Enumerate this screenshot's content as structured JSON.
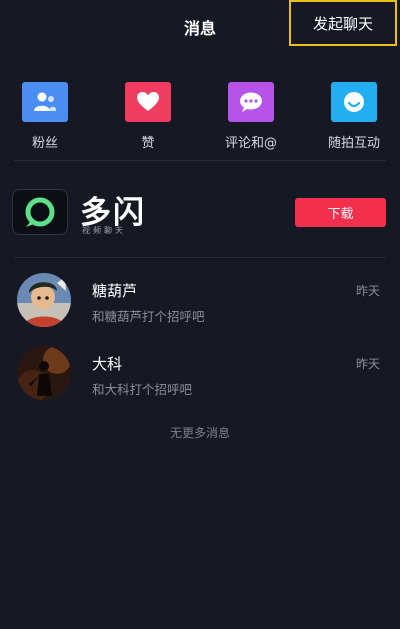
{
  "header": {
    "title": "消息",
    "start_chat_label": "发起聊天"
  },
  "quick_actions": [
    {
      "label": "粉丝",
      "icon": "fans-icon",
      "color": "#4a8ef2"
    },
    {
      "label": "赞",
      "icon": "heart-icon",
      "color": "#f03c5f"
    },
    {
      "label": "评论和@",
      "icon": "comment-icon",
      "color": "#b653e8"
    },
    {
      "label": "随拍互动",
      "icon": "smile-icon",
      "color": "#22aef0"
    }
  ],
  "ad": {
    "app_name": "多闪",
    "app_subtitle": "视频聊天",
    "download_label": "下载",
    "button_color": "#f2304e"
  },
  "conversations": [
    {
      "name": "糖葫芦",
      "preview": "和糖葫芦打个招呼吧",
      "time": "昨天"
    },
    {
      "name": "大科",
      "preview": "和大科打个招呼吧",
      "time": "昨天"
    }
  ],
  "footer": {
    "no_more_label": "无更多消息"
  }
}
